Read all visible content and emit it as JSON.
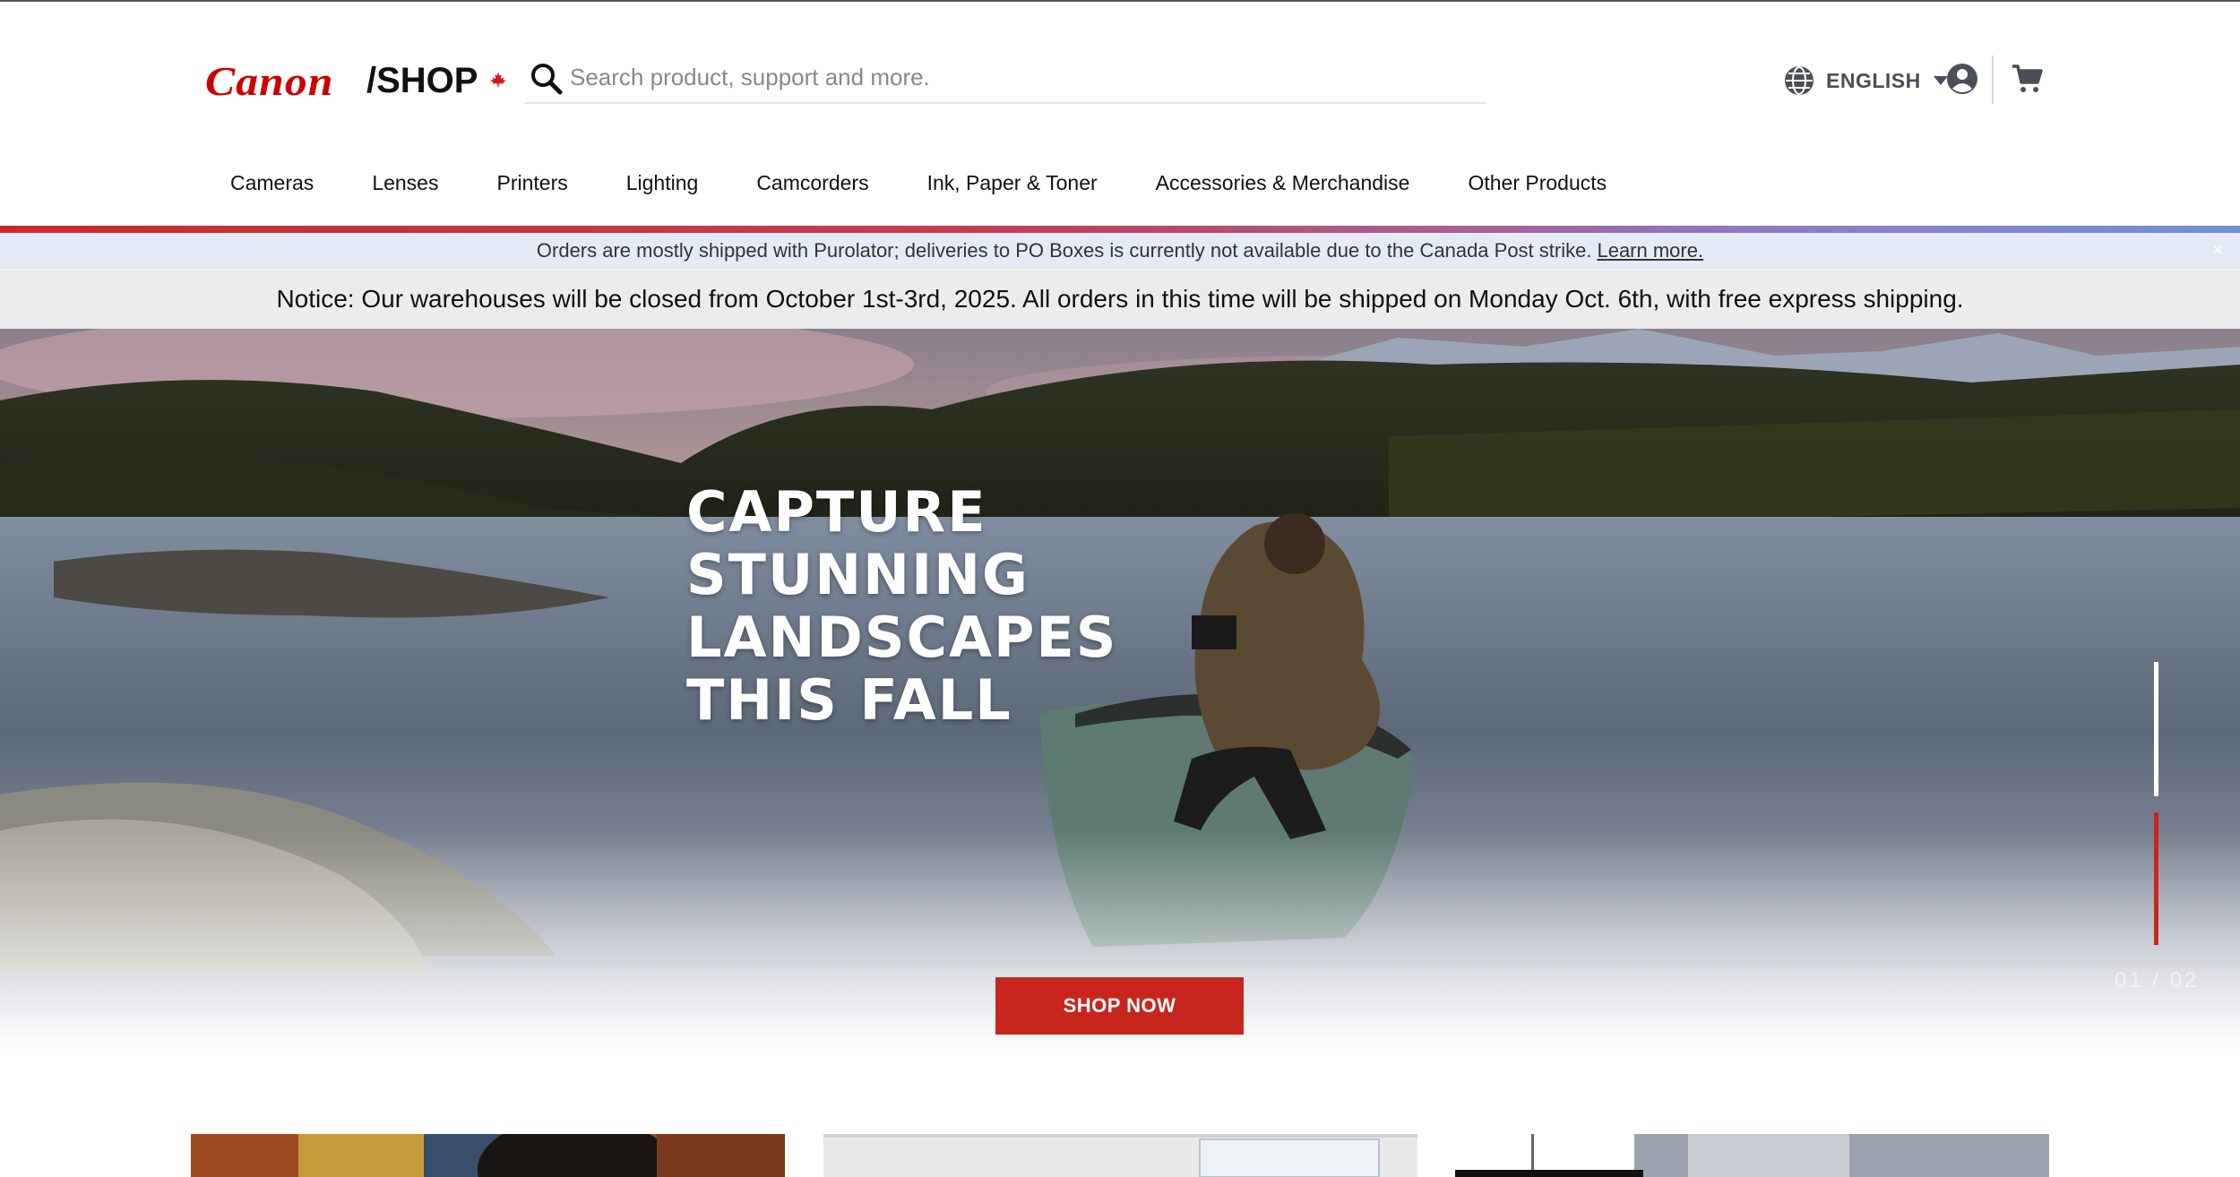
{
  "header": {
    "logo": {
      "brand": "Canon",
      "suffix": "/SHOP"
    },
    "search": {
      "placeholder": "Search product, support and more."
    },
    "language": {
      "label": "ENGLISH"
    },
    "icons": [
      "globe-icon",
      "caret-down-icon",
      "account-icon",
      "cart-icon",
      "search-icon",
      "maple-leaf-icon"
    ]
  },
  "nav": {
    "items": [
      {
        "label": "Cameras"
      },
      {
        "label": "Lenses"
      },
      {
        "label": "Printers"
      },
      {
        "label": "Lighting"
      },
      {
        "label": "Camcorders"
      },
      {
        "label": "Ink, Paper & Toner"
      },
      {
        "label": "Accessories & Merchandise"
      },
      {
        "label": "Other Products"
      }
    ]
  },
  "shipping_banner": {
    "text": "Orders are mostly shipped with Purolator; deliveries to PO Boxes is currently not available due to the Canada Post strike.",
    "link": "Learn more.",
    "close": "×"
  },
  "notice_banner": {
    "text": "Notice: Our warehouses will be closed from October 1st-3rd, 2025. All orders in this time will be shipped on Monday Oct. 6th, with free express shipping."
  },
  "hero": {
    "title_lines": [
      "CAPTURE",
      "STUNNING",
      "LANDSCAPES",
      "THIS FALL"
    ],
    "cta": "SHOP NOW",
    "slide_counter": "01 / 02"
  },
  "colors": {
    "brand_red": "#cc0000",
    "cta_red": "#c8251d",
    "shipping_bg": "#e4ebf7",
    "notice_bg": "#ececec"
  }
}
